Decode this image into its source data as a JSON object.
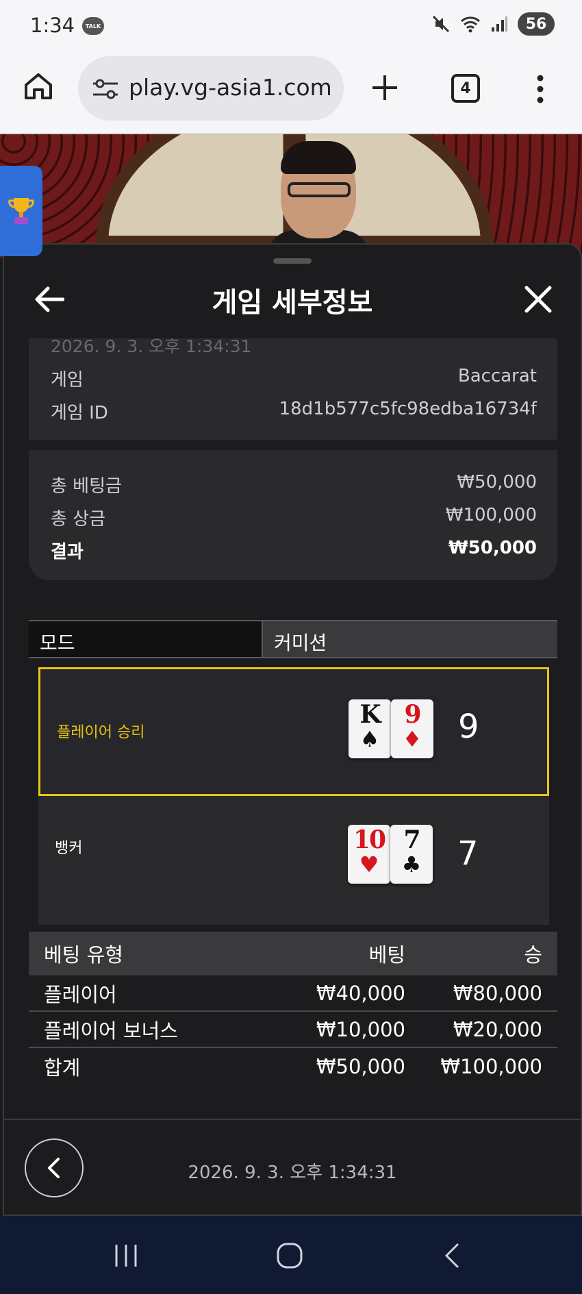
{
  "status_bar": {
    "time": "1:34",
    "talk_label": "TALK",
    "battery": "56"
  },
  "browser": {
    "url": "play.vg-asia1.com",
    "tab_count": "4"
  },
  "sheet": {
    "title": "게임 세부정보",
    "faded_datetime": "2026. 9. 3. 오후 1:34:31",
    "info": [
      {
        "label": "게임",
        "value": "Baccarat"
      },
      {
        "label": "게임 ID",
        "value": "18d1b577c5fc98edba16734f"
      }
    ],
    "summary": [
      {
        "label": "총 베팅금",
        "value": "₩50,000"
      },
      {
        "label": "총 상금",
        "value": "₩100,000"
      },
      {
        "label": "결과",
        "value": "₩50,000"
      }
    ],
    "mode": {
      "label": "모드",
      "value": "커미션"
    },
    "hands": {
      "player": {
        "label": "플레이어 승리",
        "cards": [
          {
            "rank": "K",
            "suit": "♠",
            "color": "#111111"
          },
          {
            "rank": "9",
            "suit": "♦",
            "color": "#d8141c"
          }
        ],
        "score": "9",
        "highlight_color": "#e6c415"
      },
      "banker": {
        "label": "뱅커",
        "cards": [
          {
            "rank": "10",
            "suit": "♥",
            "color": "#d8141c"
          },
          {
            "rank": "7",
            "suit": "♣",
            "color": "#111111"
          }
        ],
        "score": "7"
      }
    },
    "bets": {
      "headers": [
        "베팅 유형",
        "베팅",
        "승"
      ],
      "rows": [
        [
          "플레이어",
          "₩40,000",
          "₩80,000"
        ],
        [
          "플레이어 보너스",
          "₩10,000",
          "₩20,000"
        ]
      ],
      "total": [
        "합계",
        "₩50,000",
        "₩100,000"
      ]
    },
    "footer_datetime": "2026. 9. 3. 오후 1:34:31"
  }
}
